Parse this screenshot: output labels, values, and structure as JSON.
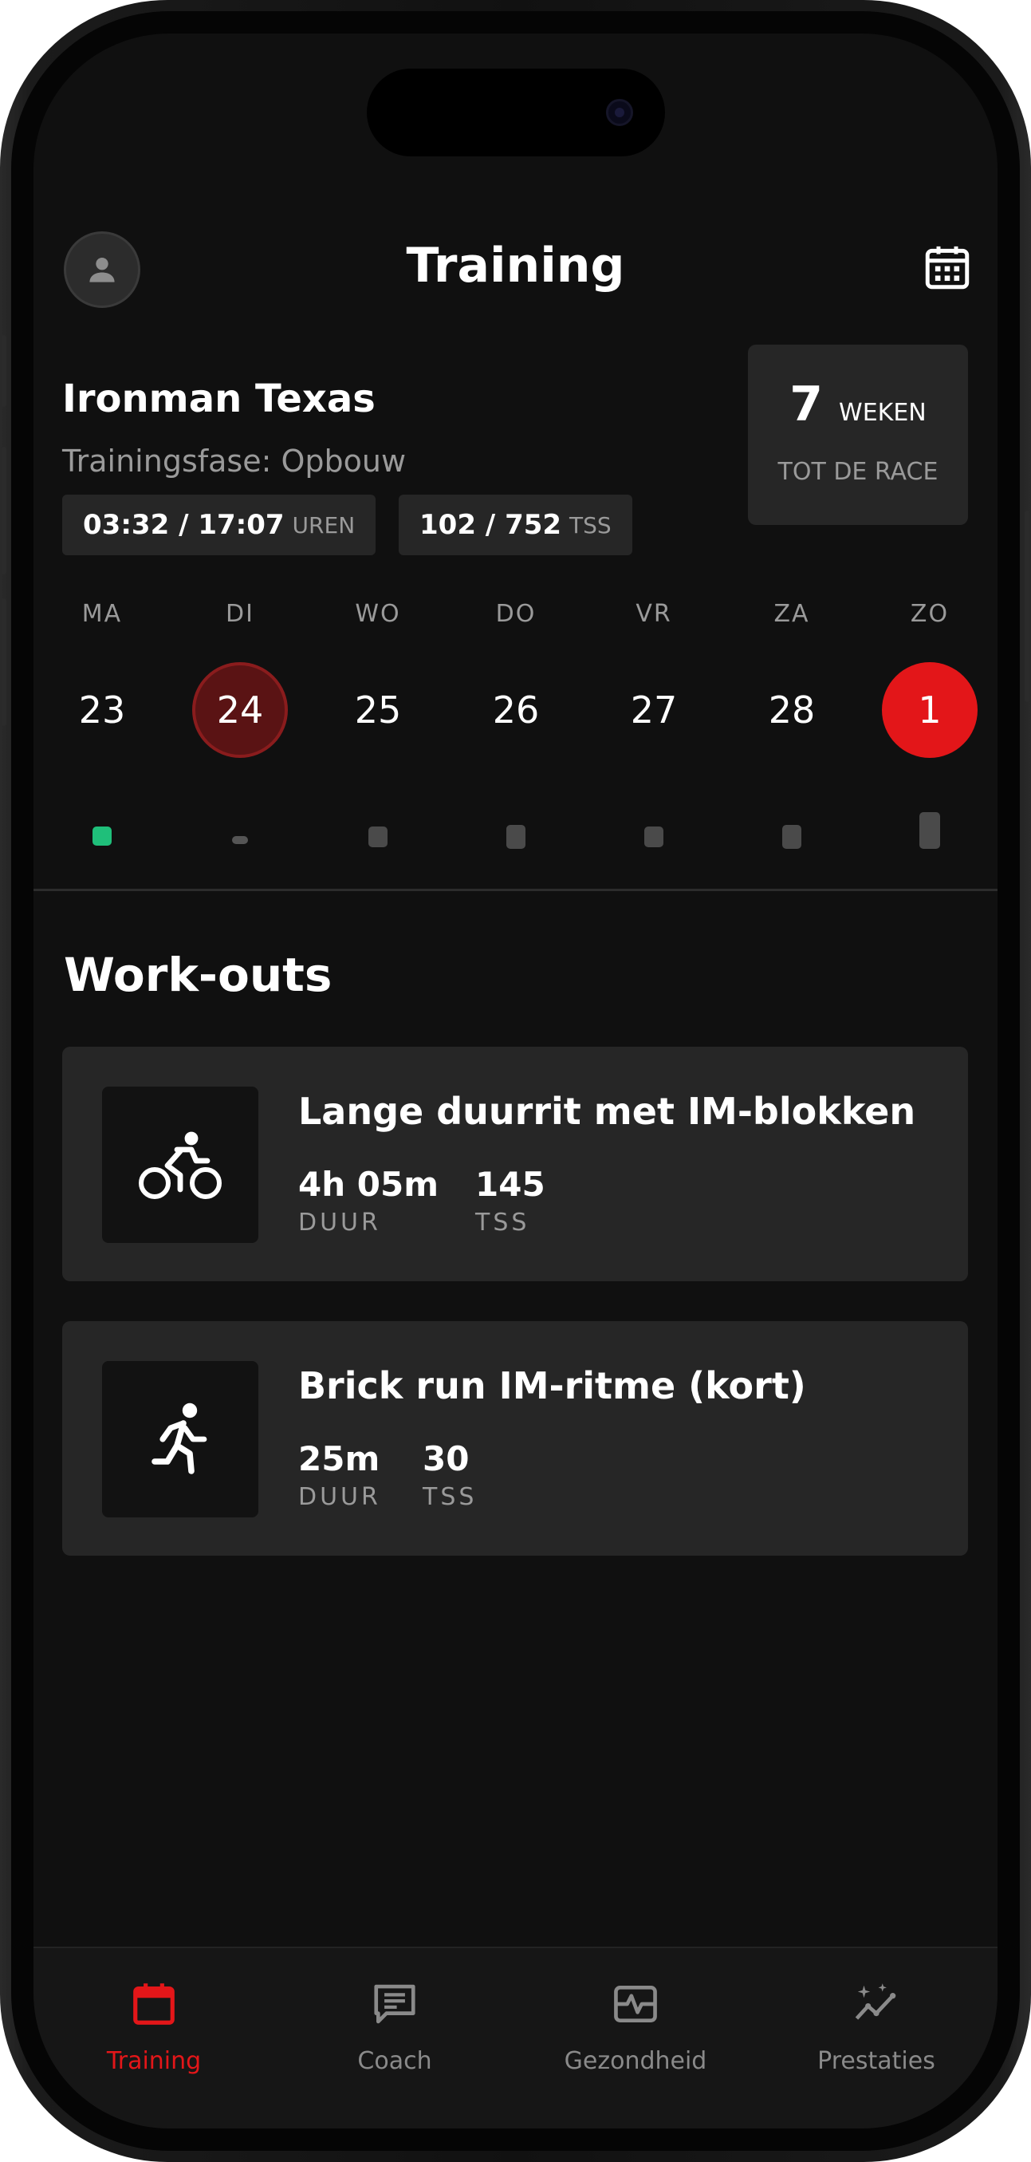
{
  "header": {
    "title": "Training"
  },
  "race": {
    "name": "Ironman Texas",
    "phase": "Trainingsfase: Opbouw",
    "hours_value": "03:32 / 17:07",
    "hours_unit": "UREN",
    "tss_value": "102 / 752",
    "tss_unit": "TSS",
    "weeks_number": "7",
    "weeks_label": "WEKEN",
    "weeks_sub": "TOT DE RACE"
  },
  "week": {
    "days": [
      {
        "label": "MA",
        "number": "23",
        "state": "default",
        "dot": "done"
      },
      {
        "label": "DI",
        "number": "24",
        "state": "current",
        "dot": "small"
      },
      {
        "label": "WO",
        "number": "25",
        "state": "default",
        "dot": "planned"
      },
      {
        "label": "DO",
        "number": "26",
        "state": "default",
        "dot": "planned"
      },
      {
        "label": "VR",
        "number": "27",
        "state": "default",
        "dot": "planned"
      },
      {
        "label": "ZA",
        "number": "28",
        "state": "default",
        "dot": "planned"
      },
      {
        "label": "ZO",
        "number": "1",
        "state": "race",
        "dot": "tall"
      }
    ]
  },
  "workouts": {
    "title": "Work-outs",
    "items": [
      {
        "icon": "bike-icon",
        "title": "Lange duurrit met IM-blokken",
        "duration": "4h 05m",
        "duration_label": "DUUR",
        "tss": "145",
        "tss_label": "TSS"
      },
      {
        "icon": "run-icon",
        "title": "Brick run IM-ritme (kort)",
        "duration": "25m",
        "duration_label": "DUUR",
        "tss": "30",
        "tss_label": "TSS"
      }
    ]
  },
  "tabs": [
    {
      "label": "Training",
      "icon": "calendar-icon",
      "active": true
    },
    {
      "label": "Coach",
      "icon": "chat-icon",
      "active": false
    },
    {
      "label": "Gezondheid",
      "icon": "health-icon",
      "active": false
    },
    {
      "label": "Prestaties",
      "icon": "performance-icon",
      "active": false
    }
  ],
  "colors": {
    "accent": "#e31619",
    "done": "#1fbf7a",
    "card": "#262626",
    "background": "#101010"
  }
}
